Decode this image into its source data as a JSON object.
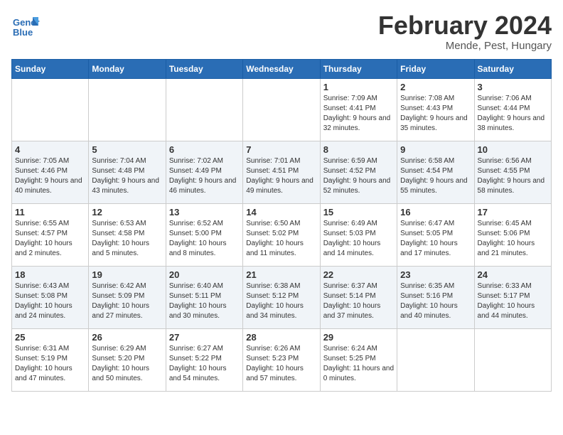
{
  "header": {
    "logo_text_top": "General",
    "logo_text_bottom": "Blue",
    "month_year": "February 2024",
    "location": "Mende, Pest, Hungary"
  },
  "days_of_week": [
    "Sunday",
    "Monday",
    "Tuesday",
    "Wednesday",
    "Thursday",
    "Friday",
    "Saturday"
  ],
  "weeks": [
    [
      {
        "day": "",
        "info": ""
      },
      {
        "day": "",
        "info": ""
      },
      {
        "day": "",
        "info": ""
      },
      {
        "day": "",
        "info": ""
      },
      {
        "day": "1",
        "info": "Sunrise: 7:09 AM\nSunset: 4:41 PM\nDaylight: 9 hours\nand 32 minutes."
      },
      {
        "day": "2",
        "info": "Sunrise: 7:08 AM\nSunset: 4:43 PM\nDaylight: 9 hours\nand 35 minutes."
      },
      {
        "day": "3",
        "info": "Sunrise: 7:06 AM\nSunset: 4:44 PM\nDaylight: 9 hours\nand 38 minutes."
      }
    ],
    [
      {
        "day": "4",
        "info": "Sunrise: 7:05 AM\nSunset: 4:46 PM\nDaylight: 9 hours\nand 40 minutes."
      },
      {
        "day": "5",
        "info": "Sunrise: 7:04 AM\nSunset: 4:48 PM\nDaylight: 9 hours\nand 43 minutes."
      },
      {
        "day": "6",
        "info": "Sunrise: 7:02 AM\nSunset: 4:49 PM\nDaylight: 9 hours\nand 46 minutes."
      },
      {
        "day": "7",
        "info": "Sunrise: 7:01 AM\nSunset: 4:51 PM\nDaylight: 9 hours\nand 49 minutes."
      },
      {
        "day": "8",
        "info": "Sunrise: 6:59 AM\nSunset: 4:52 PM\nDaylight: 9 hours\nand 52 minutes."
      },
      {
        "day": "9",
        "info": "Sunrise: 6:58 AM\nSunset: 4:54 PM\nDaylight: 9 hours\nand 55 minutes."
      },
      {
        "day": "10",
        "info": "Sunrise: 6:56 AM\nSunset: 4:55 PM\nDaylight: 9 hours\nand 58 minutes."
      }
    ],
    [
      {
        "day": "11",
        "info": "Sunrise: 6:55 AM\nSunset: 4:57 PM\nDaylight: 10 hours\nand 2 minutes."
      },
      {
        "day": "12",
        "info": "Sunrise: 6:53 AM\nSunset: 4:58 PM\nDaylight: 10 hours\nand 5 minutes."
      },
      {
        "day": "13",
        "info": "Sunrise: 6:52 AM\nSunset: 5:00 PM\nDaylight: 10 hours\nand 8 minutes."
      },
      {
        "day": "14",
        "info": "Sunrise: 6:50 AM\nSunset: 5:02 PM\nDaylight: 10 hours\nand 11 minutes."
      },
      {
        "day": "15",
        "info": "Sunrise: 6:49 AM\nSunset: 5:03 PM\nDaylight: 10 hours\nand 14 minutes."
      },
      {
        "day": "16",
        "info": "Sunrise: 6:47 AM\nSunset: 5:05 PM\nDaylight: 10 hours\nand 17 minutes."
      },
      {
        "day": "17",
        "info": "Sunrise: 6:45 AM\nSunset: 5:06 PM\nDaylight: 10 hours\nand 21 minutes."
      }
    ],
    [
      {
        "day": "18",
        "info": "Sunrise: 6:43 AM\nSunset: 5:08 PM\nDaylight: 10 hours\nand 24 minutes."
      },
      {
        "day": "19",
        "info": "Sunrise: 6:42 AM\nSunset: 5:09 PM\nDaylight: 10 hours\nand 27 minutes."
      },
      {
        "day": "20",
        "info": "Sunrise: 6:40 AM\nSunset: 5:11 PM\nDaylight: 10 hours\nand 30 minutes."
      },
      {
        "day": "21",
        "info": "Sunrise: 6:38 AM\nSunset: 5:12 PM\nDaylight: 10 hours\nand 34 minutes."
      },
      {
        "day": "22",
        "info": "Sunrise: 6:37 AM\nSunset: 5:14 PM\nDaylight: 10 hours\nand 37 minutes."
      },
      {
        "day": "23",
        "info": "Sunrise: 6:35 AM\nSunset: 5:16 PM\nDaylight: 10 hours\nand 40 minutes."
      },
      {
        "day": "24",
        "info": "Sunrise: 6:33 AM\nSunset: 5:17 PM\nDaylight: 10 hours\nand 44 minutes."
      }
    ],
    [
      {
        "day": "25",
        "info": "Sunrise: 6:31 AM\nSunset: 5:19 PM\nDaylight: 10 hours\nand 47 minutes."
      },
      {
        "day": "26",
        "info": "Sunrise: 6:29 AM\nSunset: 5:20 PM\nDaylight: 10 hours\nand 50 minutes."
      },
      {
        "day": "27",
        "info": "Sunrise: 6:27 AM\nSunset: 5:22 PM\nDaylight: 10 hours\nand 54 minutes."
      },
      {
        "day": "28",
        "info": "Sunrise: 6:26 AM\nSunset: 5:23 PM\nDaylight: 10 hours\nand 57 minutes."
      },
      {
        "day": "29",
        "info": "Sunrise: 6:24 AM\nSunset: 5:25 PM\nDaylight: 11 hours\nand 0 minutes."
      },
      {
        "day": "",
        "info": ""
      },
      {
        "day": "",
        "info": ""
      }
    ]
  ]
}
